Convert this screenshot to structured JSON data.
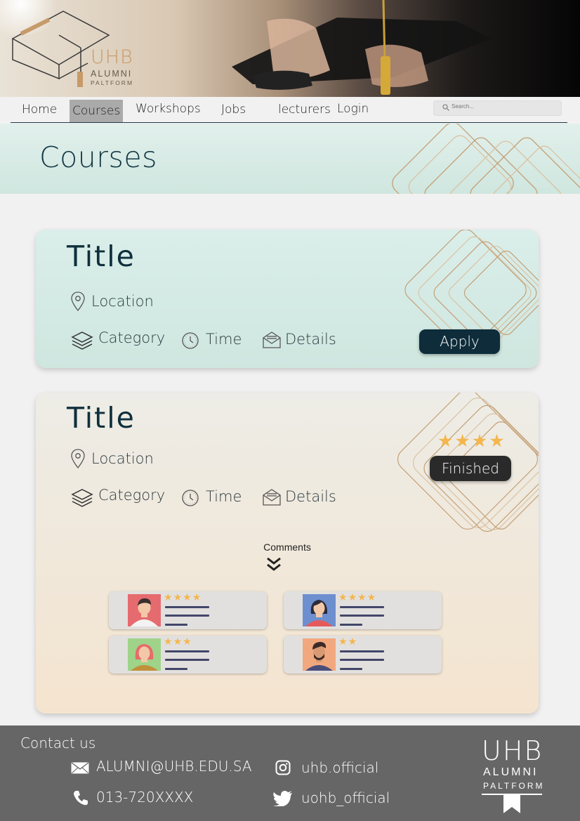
{
  "hero": {
    "logo_main": "UHB",
    "logo_line1": "ALUMNI",
    "logo_line2": "PALTFORM"
  },
  "nav": {
    "items": [
      "Home",
      "Courses",
      "Workshops",
      "Jobs",
      "lecturers",
      "Login"
    ],
    "active": "Courses",
    "search_placeholder": "Search..."
  },
  "page": {
    "title": "Courses"
  },
  "courses": [
    {
      "title": "Title",
      "location": "Location",
      "category": "Category",
      "time": "Time",
      "details": "Details",
      "action_label": "Apply"
    },
    {
      "title": "Title",
      "location": "Location",
      "category": "Category",
      "time": "Time",
      "details": "Details",
      "rating": 4,
      "status_label": "Finished",
      "comments_label": "Comments",
      "comments": [
        {
          "rating": 4,
          "avatar": "avatar-man-dark-hair"
        },
        {
          "rating": 4,
          "avatar": "avatar-woman-dark-hair"
        },
        {
          "rating": 3,
          "avatar": "avatar-woman-red-hair"
        },
        {
          "rating": 2,
          "avatar": "avatar-man-beard"
        }
      ]
    }
  ],
  "footer": {
    "contact_title": "Contact us",
    "email": "ALUMNI@UHB.EDU.SA",
    "phone": "013-720XXXX",
    "instagram": "uhb.official",
    "twitter": "uohb_official",
    "logo_main": "UHB",
    "logo_line1": "ALUMNI",
    "logo_line2": "PALTFORM"
  },
  "colors": {
    "dark_teal": "#0e2c3a",
    "star": "#f4b64d",
    "footer_bg": "#666666",
    "logo_gold": "#c79a6a"
  }
}
